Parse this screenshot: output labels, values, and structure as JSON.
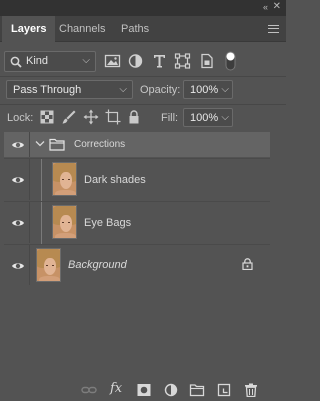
{
  "panel": {
    "collapse_glyph": "«",
    "close_glyph": "✕",
    "tabs": [
      {
        "label": "Layers",
        "active": true
      },
      {
        "label": "Channels",
        "active": false
      },
      {
        "label": "Paths",
        "active": false
      }
    ]
  },
  "filter": {
    "kind_label": "Kind",
    "icons": [
      "pixel-filter-icon",
      "adjustment-filter-icon",
      "type-filter-icon",
      "shape-filter-icon",
      "smart-object-filter-icon",
      "filter-toggle-icon"
    ]
  },
  "blending": {
    "mode": "Pass Through",
    "opacity_label": "Opacity:",
    "opacity_value": "100%",
    "fill_label": "Fill:",
    "fill_value": "100%"
  },
  "lock": {
    "label": "Lock:",
    "icons": [
      "lock-transparent-pixels-icon",
      "lock-image-pixels-icon",
      "lock-position-icon",
      "lock-artboard-icon",
      "lock-all-icon"
    ]
  },
  "layers": [
    {
      "name": "Corrections",
      "type": "group",
      "expanded": true,
      "visible": true
    },
    {
      "name": "Dark shades",
      "type": "layer",
      "visible": true
    },
    {
      "name": "Eye Bags",
      "type": "layer",
      "visible": true
    },
    {
      "name": "Background",
      "type": "background",
      "visible": true,
      "locked": true
    }
  ],
  "bottom_icons": [
    "link-layers-icon",
    "fx-icon",
    "add-mask-icon",
    "new-adjustment-icon",
    "new-group-icon",
    "new-layer-icon",
    "delete-layer-icon"
  ],
  "fx_label": "fx",
  "colors": {
    "panel_bg": "#535353",
    "selected_group_bg": "#646464",
    "tab_bar_bg": "#424242"
  }
}
